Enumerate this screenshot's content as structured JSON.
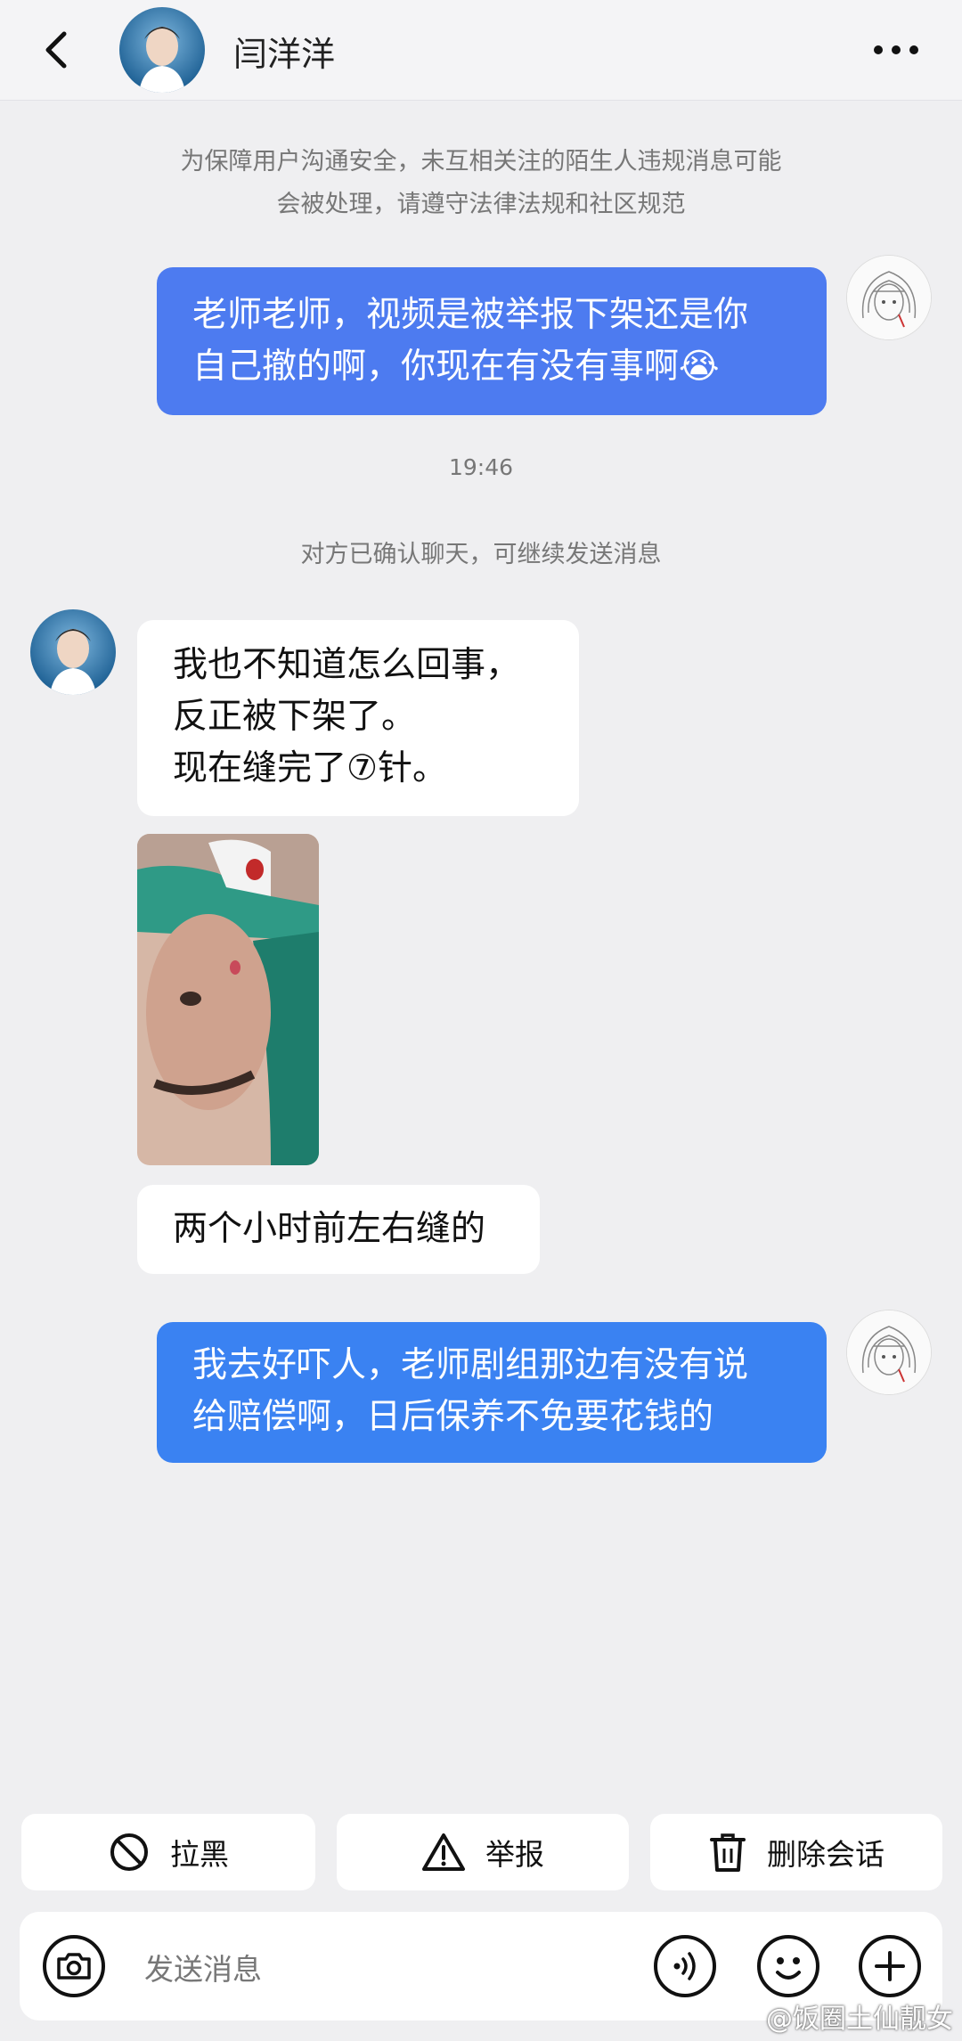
{
  "header": {
    "back_icon": "chevron-left-icon",
    "contact_name": "闫洋洋",
    "more_icon": "more-horizontal-icon"
  },
  "notice": {
    "line1": "为保障用户沟通安全，未互相关注的陌生人违规消息可能",
    "line2": "会被处理，请遵守法律法规和社区规范"
  },
  "messages": [
    {
      "direction": "out",
      "lines": [
        "老师老师，视频是被举报下架还是你",
        "自己撤的啊，你现在有没有事啊😭"
      ]
    },
    {
      "type": "timestamp",
      "text": "19:46"
    },
    {
      "type": "system",
      "text": "对方已确认聊天，可继续发送消息"
    },
    {
      "direction": "in",
      "lines": [
        "我也不知道怎么回事，",
        "反正被下架了。",
        "现在缝完了⑦针。"
      ]
    },
    {
      "direction": "in",
      "type": "image",
      "icon": "photo-thumbnail"
    },
    {
      "direction": "in",
      "lines": [
        "两个小时前左右缝的"
      ]
    },
    {
      "direction": "out",
      "lines": [
        "我去好吓人，老师剧组那边有没有说",
        "给赔偿啊，日后保养不免要花钱的"
      ]
    }
  ],
  "actions": [
    {
      "label": "拉黑",
      "icon": "block-icon"
    },
    {
      "label": "举报",
      "icon": "warning-icon"
    },
    {
      "label": "删除会话",
      "icon": "trash-icon"
    }
  ],
  "input": {
    "placeholder": "发送消息",
    "camera_icon": "camera-icon",
    "voice_icon": "voice-icon",
    "emoji_icon": "emoji-icon",
    "plus_icon": "plus-icon"
  },
  "watermark": "@饭圈土仙靓女",
  "colors": {
    "background": "#efeff1",
    "outgoing_bubble": "#4d7bf0",
    "incoming_bubble": "#ffffff"
  }
}
